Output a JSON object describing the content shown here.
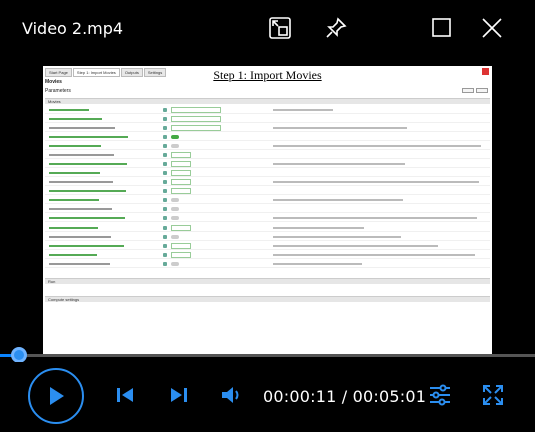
{
  "window": {
    "title": "Video 2.mp4"
  },
  "title_buttons": {
    "miniplayer": "miniplayer-icon",
    "pin": "pin-icon",
    "maximize": "maximize-icon",
    "close": "close-icon"
  },
  "video_frame": {
    "slide_title": "Step 1: Import Movies",
    "app_tabs": [
      "Start Page",
      "Step 1: Import Movies",
      "Outputs",
      "Settings"
    ],
    "heading": "Movies",
    "section_label": "Parameters",
    "sections": [
      "Movies",
      "Run",
      "Compute settings"
    ]
  },
  "progress": {
    "fraction": 0.036
  },
  "controls": {
    "play": "play-icon",
    "previous": "skip-previous-icon",
    "next": "skip-next-icon",
    "volume": "volume-icon",
    "time_display": "00:00:11 / 00:05:01",
    "settings": "settings-sliders-icon",
    "fullscreen": "fullscreen-icon"
  },
  "colors": {
    "accent": "#2b8ef0",
    "background": "#000000"
  }
}
